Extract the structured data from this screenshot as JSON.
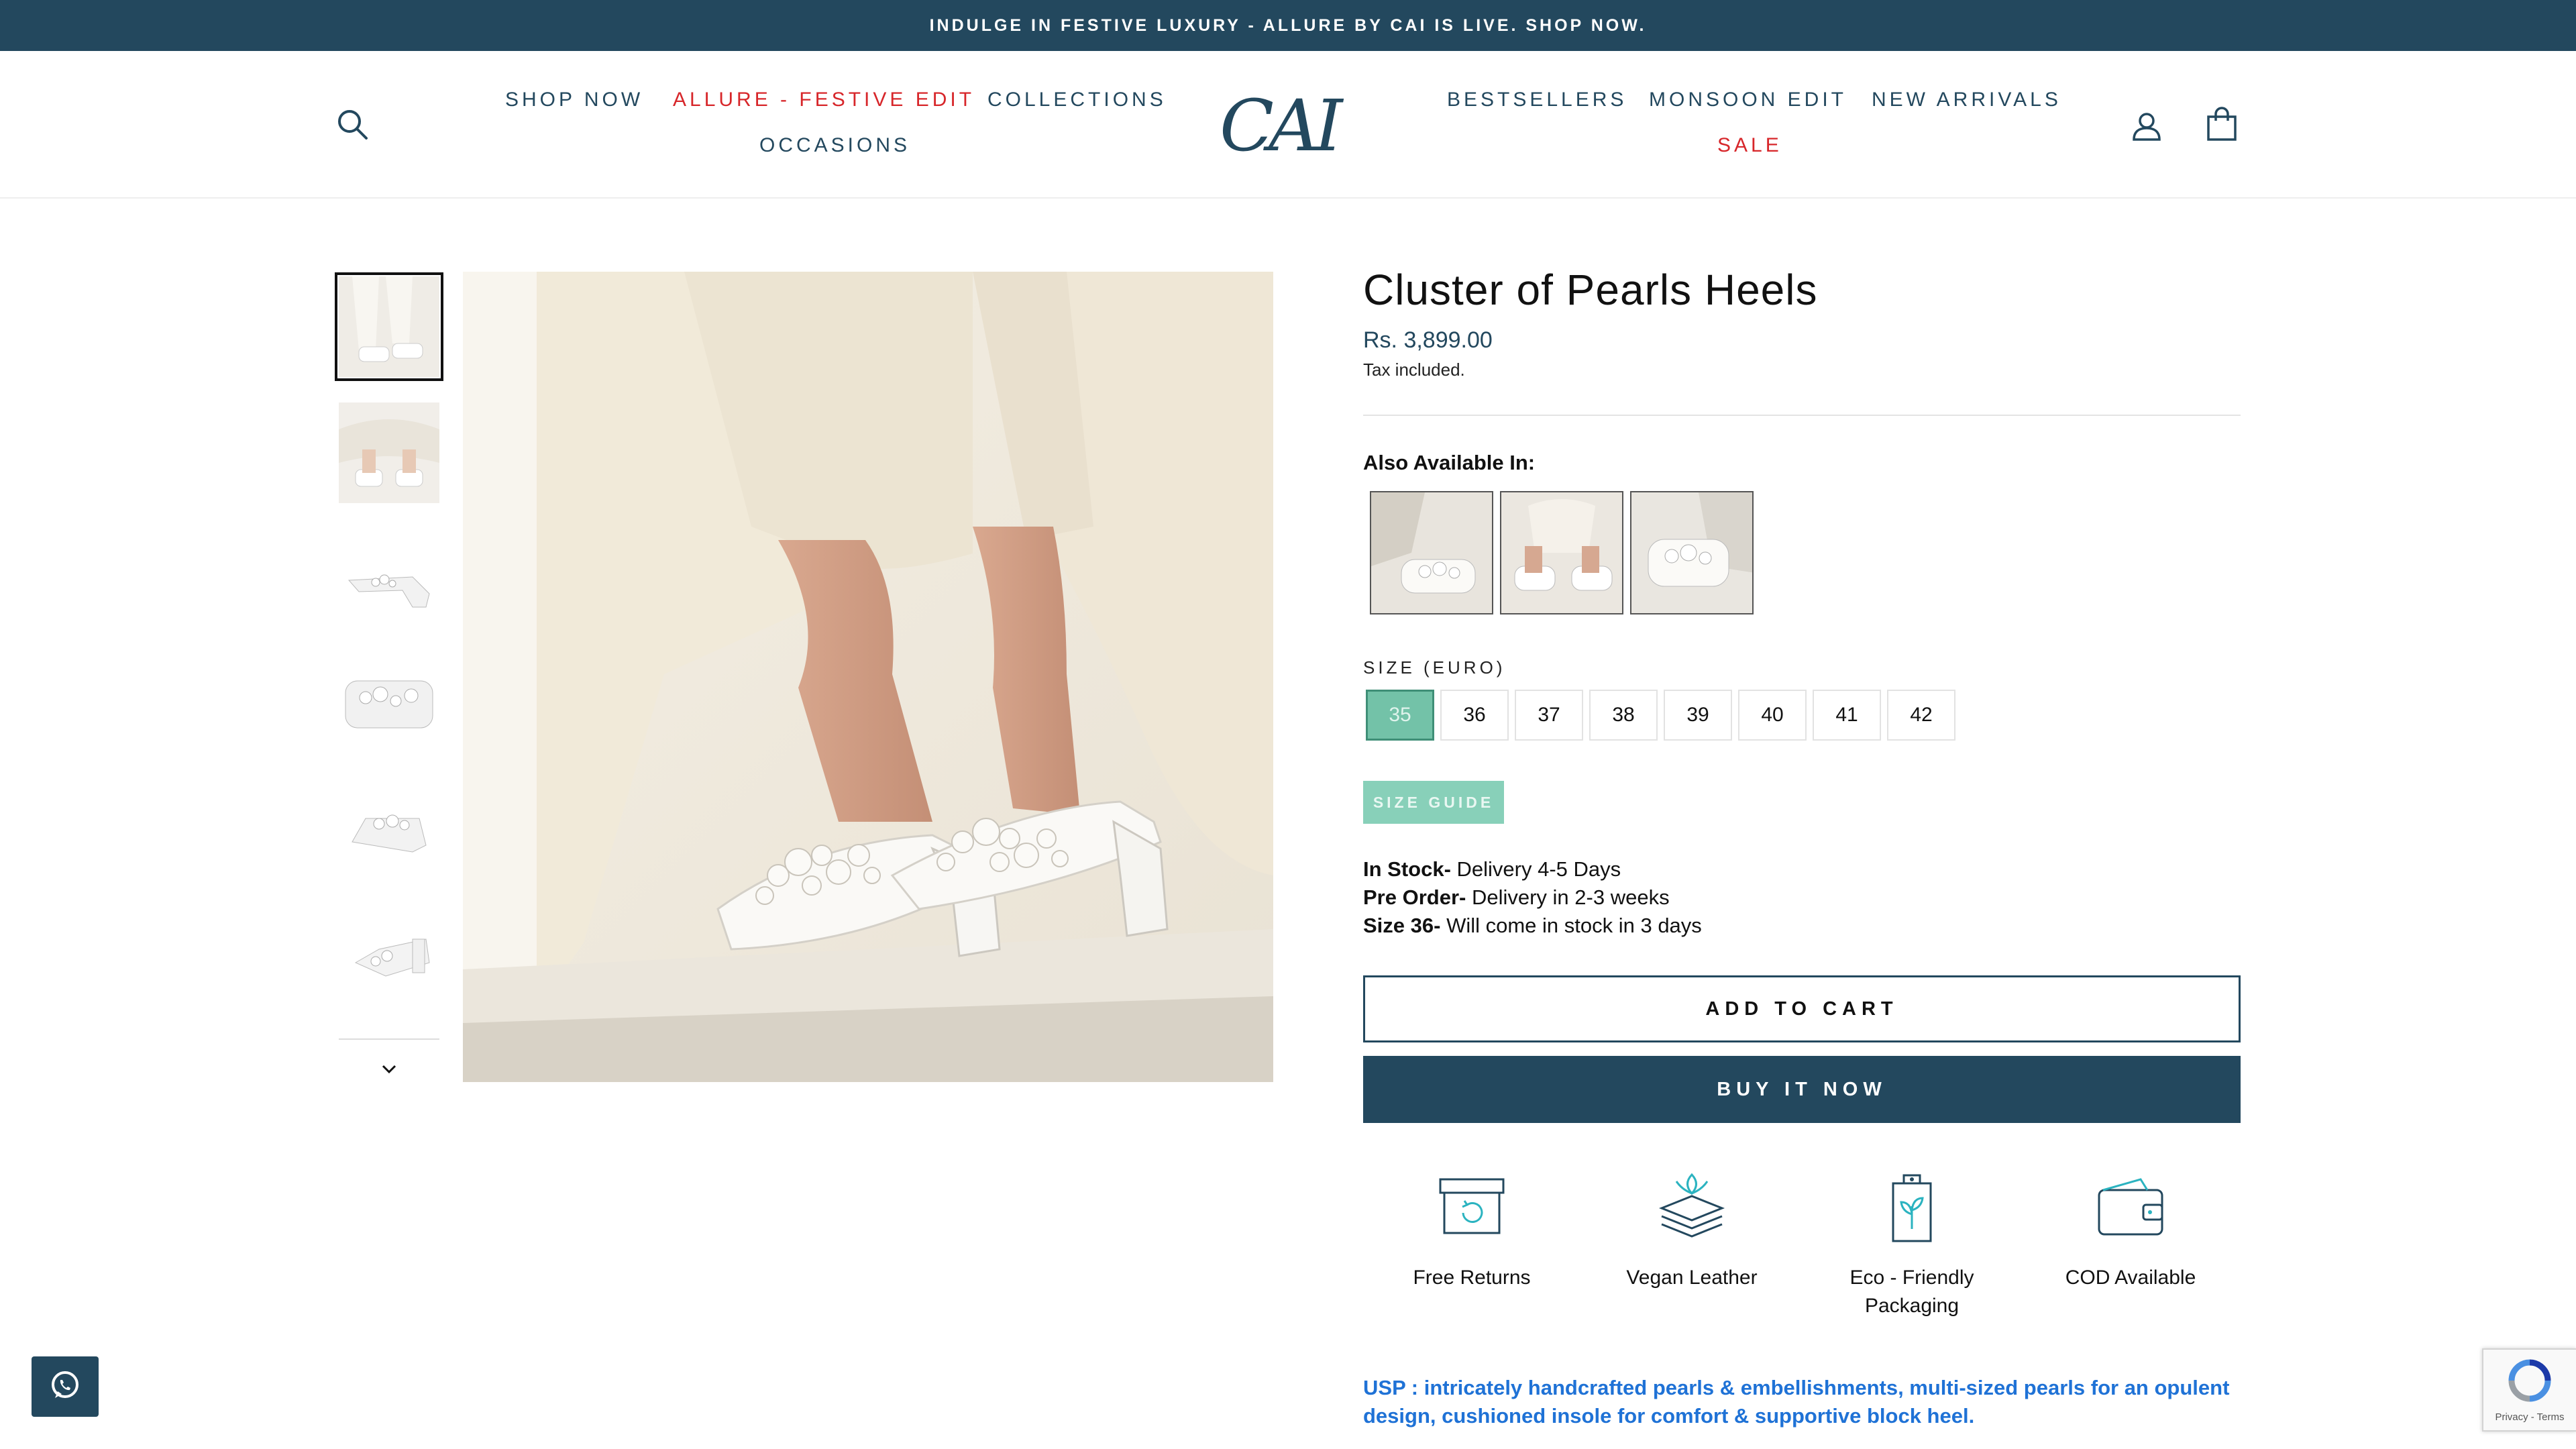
{
  "announcement": "INDULGE IN FESTIVE LUXURY - ALLURE BY CAI IS LIVE. SHOP NOW.",
  "header": {
    "logo_text": "CAI",
    "nav_left": [
      "SHOP NOW",
      "ALLURE - FESTIVE EDIT",
      "COLLECTIONS",
      "OCCASIONS"
    ],
    "nav_right": [
      "BESTSELLERS",
      "MONSOON EDIT",
      "NEW ARRIVALS",
      "SALE"
    ],
    "icons": [
      "search-icon",
      "account-icon",
      "cart-icon"
    ]
  },
  "gallery": {
    "thumbnails": [
      "thumbnail-1",
      "thumbnail-2",
      "thumbnail-3",
      "thumbnail-4",
      "thumbnail-5",
      "thumbnail-6"
    ],
    "active_thumbnail": 1,
    "next_icon": "chevron-down-icon"
  },
  "product": {
    "title": "Cluster of Pearls Heels",
    "price": "Rs. 3,899.00",
    "tax_note": "Tax included.",
    "also_available_label": "Also Available In:",
    "size_label": "SIZE (EURO)",
    "sizes": [
      "35",
      "36",
      "37",
      "38",
      "39",
      "40",
      "41",
      "42"
    ],
    "selected_size": "35",
    "size_guide": "SIZE GUIDE",
    "stock": [
      {
        "label": "In Stock-",
        "text": " Delivery 4-5 Days"
      },
      {
        "label": "Pre Order-",
        "text": " Delivery in 2-3 weeks"
      },
      {
        "label": "Size 36-",
        "text": " Will come in stock in 3 days"
      }
    ],
    "add_to_cart": "ADD TO CART",
    "buy_now": "BUY IT NOW",
    "features": [
      {
        "icon": "box-return-icon",
        "label": "Free Returns"
      },
      {
        "icon": "leaf-layers-icon",
        "label": "Vegan Leather"
      },
      {
        "icon": "eco-tag-icon",
        "label": "Eco - Friendly Packaging"
      },
      {
        "icon": "wallet-icon",
        "label": "COD Available"
      }
    ],
    "usp": "USP : intricately handcrafted pearls & embellishments, multi-sized pearls for an opulent design, cushioned insole for comfort & supportive block heel."
  },
  "floating": {
    "whatsapp_icon": "whatsapp-icon",
    "recaptcha_text": "Privacy - Terms"
  },
  "colors": {
    "brand_navy": "#23485e",
    "sale_red": "#d7262a",
    "selected_size": "#73c2a8",
    "usp_blue": "#1f72d6"
  }
}
